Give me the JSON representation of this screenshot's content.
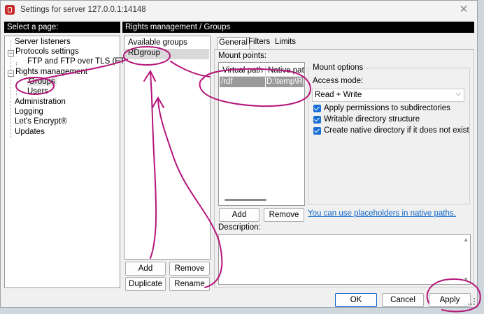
{
  "window": {
    "title": "Settings for server 127.0.0.1:14148"
  },
  "select_page_header": "Select a page:",
  "main_header": "Rights management / Groups",
  "nav_tree": [
    {
      "label": "Server listeners"
    },
    {
      "label": "Protocols settings"
    },
    {
      "label": "FTP and FTP over TLS (FTPS)"
    },
    {
      "label": "Rights management"
    },
    {
      "label": "Groups"
    },
    {
      "label": "Users"
    },
    {
      "label": "Administration"
    },
    {
      "label": "Logging"
    },
    {
      "label": "Let's Encrypt®"
    },
    {
      "label": "Updates"
    }
  ],
  "groups": {
    "title": "Available groups",
    "items": [
      "RDgroup"
    ],
    "add_label": "Add",
    "remove_label": "Remove",
    "duplicate_label": "Duplicate",
    "rename_label": "Rename"
  },
  "tabs": [
    "General",
    "Filters",
    "Limits"
  ],
  "mount_points": {
    "label": "Mount points:",
    "columns": [
      "Virtual path",
      "Native path"
    ],
    "rows": [
      {
        "virtual": "/rdf",
        "native": "D:\\temp\\RD"
      }
    ],
    "add_label": "Add",
    "remove_label": "Remove",
    "placeholder_link": "You can use placeholders in native paths."
  },
  "mount_options": {
    "title": "Mount options",
    "access_mode_label": "Access mode:",
    "access_mode_value": "Read + Write",
    "checkboxes": [
      {
        "label": "Apply permissions to subdirectories",
        "checked": true
      },
      {
        "label": "Writable directory structure",
        "checked": true
      },
      {
        "label": "Create native directory if it does not exist",
        "checked": true
      }
    ]
  },
  "description_label": "Description:",
  "footer": {
    "ok_label": "OK",
    "cancel_label": "Cancel",
    "apply_label": "Apply"
  },
  "colors": {
    "annotation": "#b5157a",
    "link": "#0a64c8",
    "selection": "#d9d9d9"
  }
}
